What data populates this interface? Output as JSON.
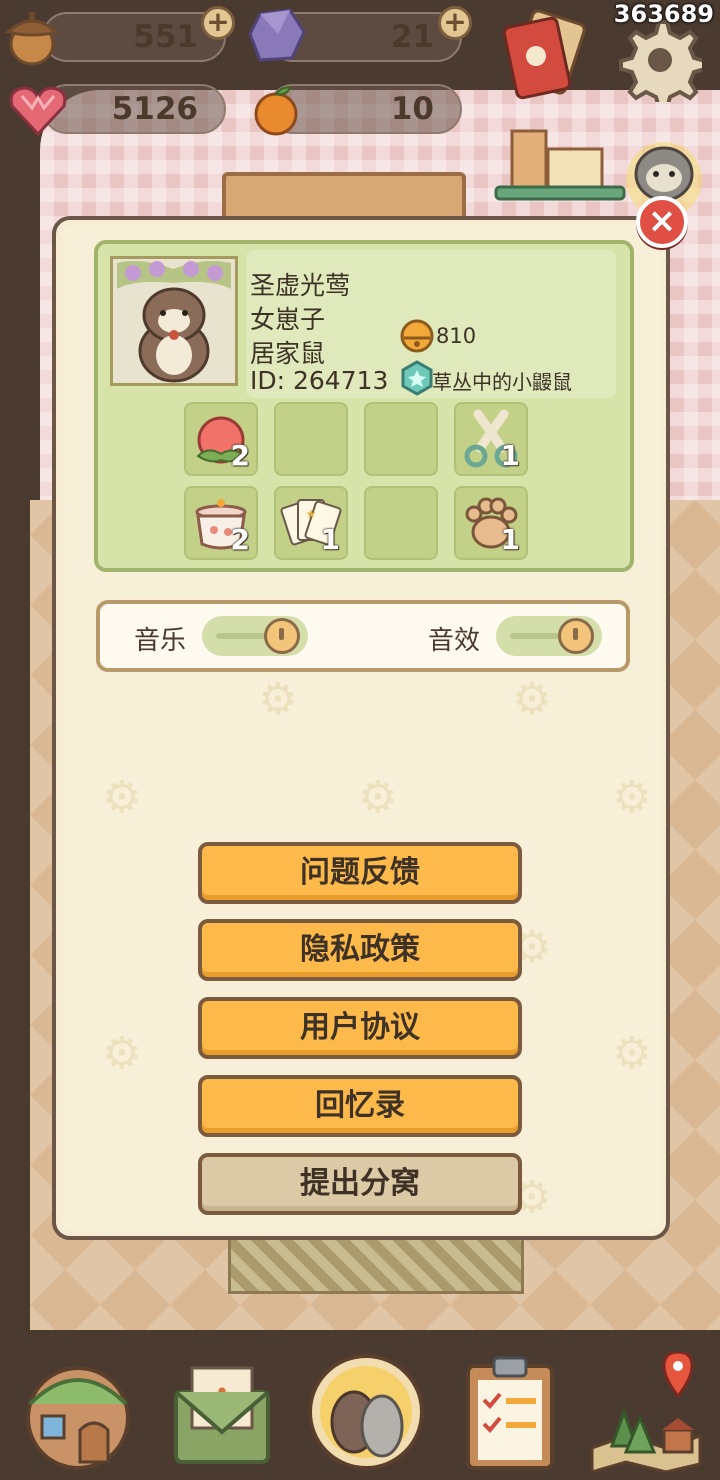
{
  "top_id": "363689",
  "resources": {
    "acorn": "551",
    "crystal": "21",
    "heart": "5126",
    "orange": "10"
  },
  "close_label": "×",
  "profile": {
    "name": "圣虚光莺",
    "gender": "女崽子",
    "type": "居家鼠",
    "id": "ID: 264713",
    "bells": "810",
    "badge": "草丛中的小鼹鼠"
  },
  "items": [
    {
      "icon": "peach-icon",
      "count": "2"
    },
    {
      "icon": "empty-slot",
      "count": ""
    },
    {
      "icon": "empty-slot",
      "count": ""
    },
    {
      "icon": "scissors-icon",
      "count": "1"
    },
    {
      "icon": "pot-icon",
      "count": "2"
    },
    {
      "icon": "cards-icon",
      "count": "1"
    },
    {
      "icon": "empty-slot",
      "count": ""
    },
    {
      "icon": "paw-icon",
      "count": "1"
    }
  ],
  "settings": {
    "music_label": "音乐",
    "sfx_label": "音效",
    "music_on": true,
    "sfx_on": true
  },
  "menu": {
    "feedback": "问题反馈",
    "privacy": "隐私政策",
    "agreement": "用户协议",
    "memories": "回忆录",
    "leave_nest": "提出分窝"
  },
  "colors": {
    "primary_button": "#fdb94a",
    "secondary_button": "#dcc9a6",
    "card_green": "#d6e3a9",
    "close_red": "#e04f43"
  },
  "nav": [
    "house-icon",
    "letter-icon",
    "hamster-icon",
    "clipboard-icon",
    "map-icon"
  ]
}
